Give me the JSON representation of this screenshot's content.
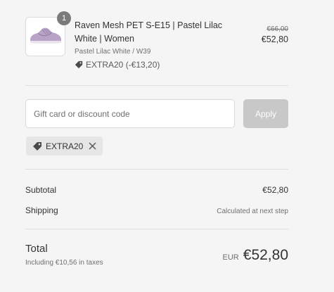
{
  "product": {
    "quantity": "1",
    "title": "Raven Mesh PET S-E15 | Pastel Lilac White | Women",
    "variant": "Pastel Lilac White / W39",
    "discount_code_applied": "EXTRA20 (-€13,20)",
    "original_price": "€66,00",
    "price": "€52,80",
    "image_icon": "sneaker-image"
  },
  "discount_form": {
    "placeholder": "Gift card or discount code",
    "apply_label": "Apply"
  },
  "applied_code": {
    "code": "EXTRA20",
    "remove_icon": "close-icon"
  },
  "totals": {
    "subtotal_label": "Subtotal",
    "subtotal_value": "€52,80",
    "shipping_label": "Shipping",
    "shipping_value": "Calculated at next step",
    "total_label": "Total",
    "tax_note": "Including €10,56 in taxes",
    "currency": "EUR",
    "total_value": "€52,80"
  },
  "colors": {
    "background": "#f5f5f5",
    "apply_button_disabled": "#c8c8c8",
    "chip_background": "#e6e6e6",
    "badge": "#7b7b7b"
  }
}
